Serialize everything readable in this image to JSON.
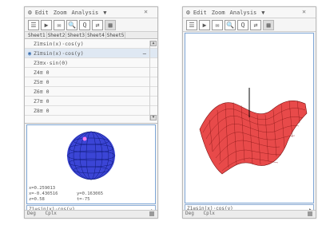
{
  "screens": [
    {
      "menu": [
        "Edit",
        "Zoom",
        "Analysis",
        "▼"
      ],
      "toolbar": [
        "☰",
        "▶",
        "✉",
        "🔍",
        "Q",
        "⇄",
        "▦"
      ],
      "tabs": [
        "Sheet1",
        "Sheet2",
        "Sheet3",
        "Sheet4",
        "Sheet5"
      ],
      "equations": [
        {
          "text": "Z1≡sin(x)·cos(y)",
          "selected": false,
          "mark": ""
        },
        {
          "text": "Z1≡sin(x)·cos(y)",
          "selected": true,
          "mark": "◉",
          "right": "—"
        },
        {
          "text": "Z3≡x·sin(0)",
          "selected": false,
          "mark": ""
        },
        {
          "text": "Z4≡ 0",
          "selected": false,
          "mark": ""
        },
        {
          "text": "Z5≡ 0",
          "selected": false,
          "mark": ""
        },
        {
          "text": "Z6≡ 0",
          "selected": false,
          "mark": ""
        },
        {
          "text": "Z7≡ 0",
          "selected": false,
          "mark": ""
        },
        {
          "text": "Z8≡ 0",
          "selected": false,
          "mark": ""
        }
      ],
      "coords": {
        "line1": "x=0.259013",
        "line2a": "x=-0.430516",
        "line2b": "y=0.163065",
        "line3a": "z=0.58",
        "line3b": "t=-75"
      },
      "edit_line": "Z1≡sin(x)·cos(y)",
      "edit_btn": "▸",
      "status": [
        "Deg",
        "Cplx"
      ]
    },
    {
      "menu": [
        "Edit",
        "Zoom",
        "Analysis",
        "▼"
      ],
      "toolbar": [
        "☰",
        "▶",
        "✉",
        "🔍",
        "Q",
        "⇄",
        "▦"
      ],
      "edit_line": "Z1≡sin(x)·cos(y)",
      "edit_btn": "▸",
      "status": [
        "Deg",
        "Cplx"
      ]
    }
  ],
  "colors": {
    "sphere_fill": "#3b45d6",
    "sphere_grid": "#0f1a7a",
    "surface_fill": "#e84a4a",
    "surface_grid": "#7a1010",
    "accent_border": "#7ea6d6"
  },
  "icons": {
    "settings": "gear-icon",
    "close": "close-icon"
  }
}
